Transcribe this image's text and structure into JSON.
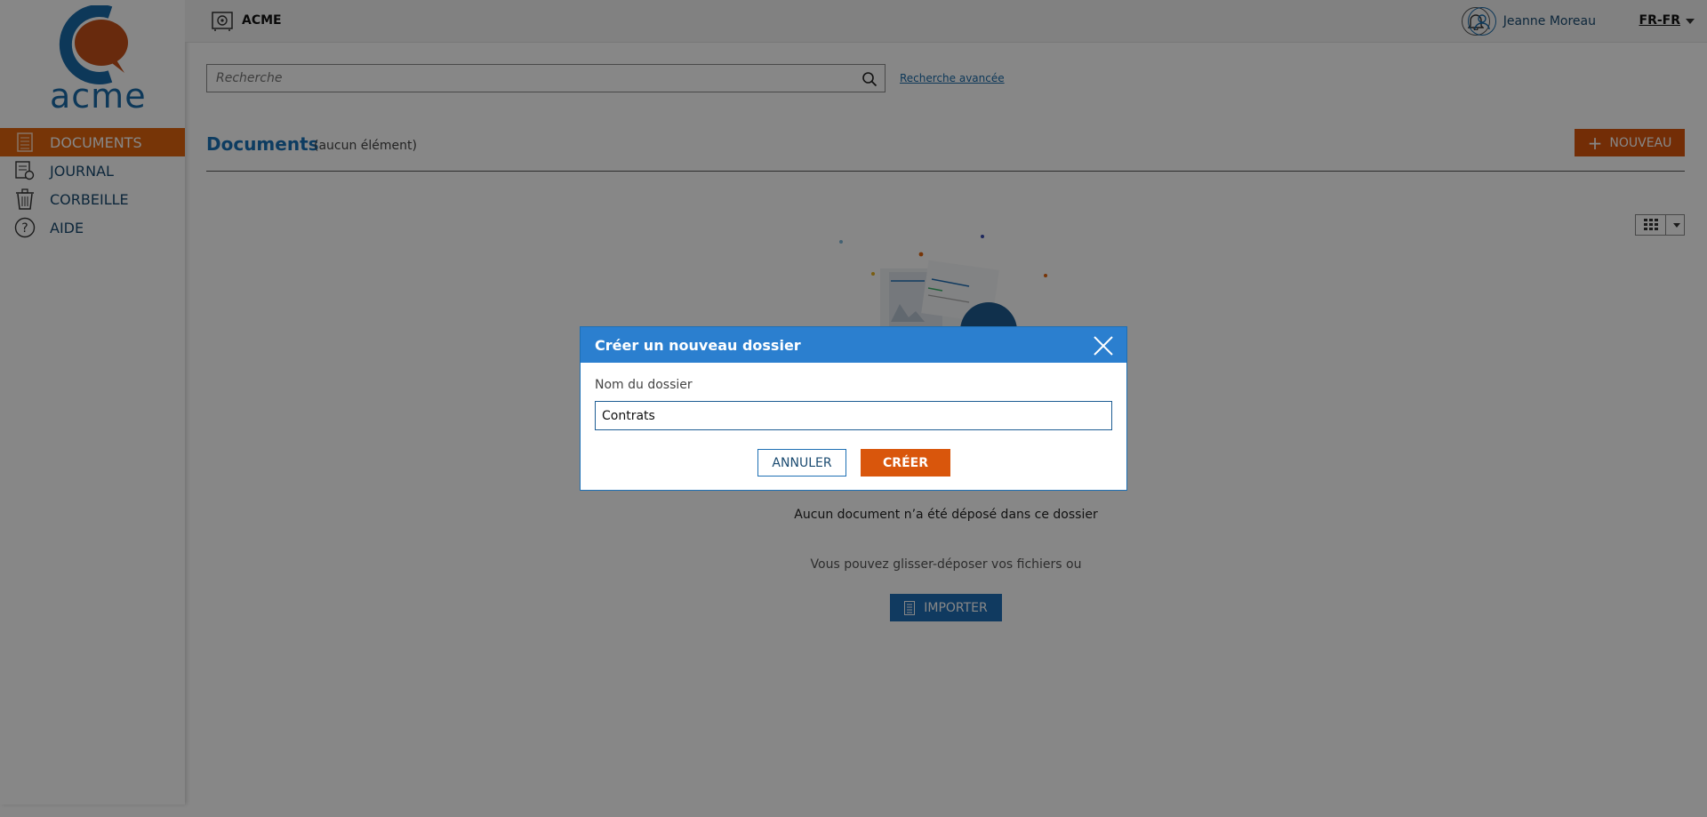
{
  "brand": {
    "logo_text": "acme",
    "app_name": "ACME"
  },
  "sidebar": {
    "items": [
      {
        "label": "DOCUMENTS",
        "icon": "document-icon",
        "active": true
      },
      {
        "label": "JOURNAL",
        "icon": "journal-icon",
        "active": false
      },
      {
        "label": "CORBEILLE",
        "icon": "trash-icon",
        "active": false
      },
      {
        "label": "AIDE",
        "icon": "help-icon",
        "active": false
      }
    ]
  },
  "header": {
    "user_name": "Jeanne Moreau",
    "language": "FR-FR"
  },
  "search": {
    "placeholder": "Recherche",
    "advanced_link": "Recherche avancée"
  },
  "main": {
    "title": "Documents",
    "count_text": "(aucun élément)",
    "new_button": "NOUVEAU",
    "empty_message": "Aucun document n’a été déposé dans ce dossier",
    "drag_message": "Vous pouvez glisser-déposer vos fichiers ou",
    "import_button": "IMPORTER"
  },
  "modal": {
    "title": "Créer un nouveau dossier",
    "field_label": "Nom du dossier",
    "field_value": "Contrats",
    "cancel_label": "ANNULER",
    "create_label": "CRÉER"
  },
  "colors": {
    "accent_orange": "#d9560c",
    "primary_blue": "#1f6fb5",
    "header_blue": "#2b7fcf"
  }
}
